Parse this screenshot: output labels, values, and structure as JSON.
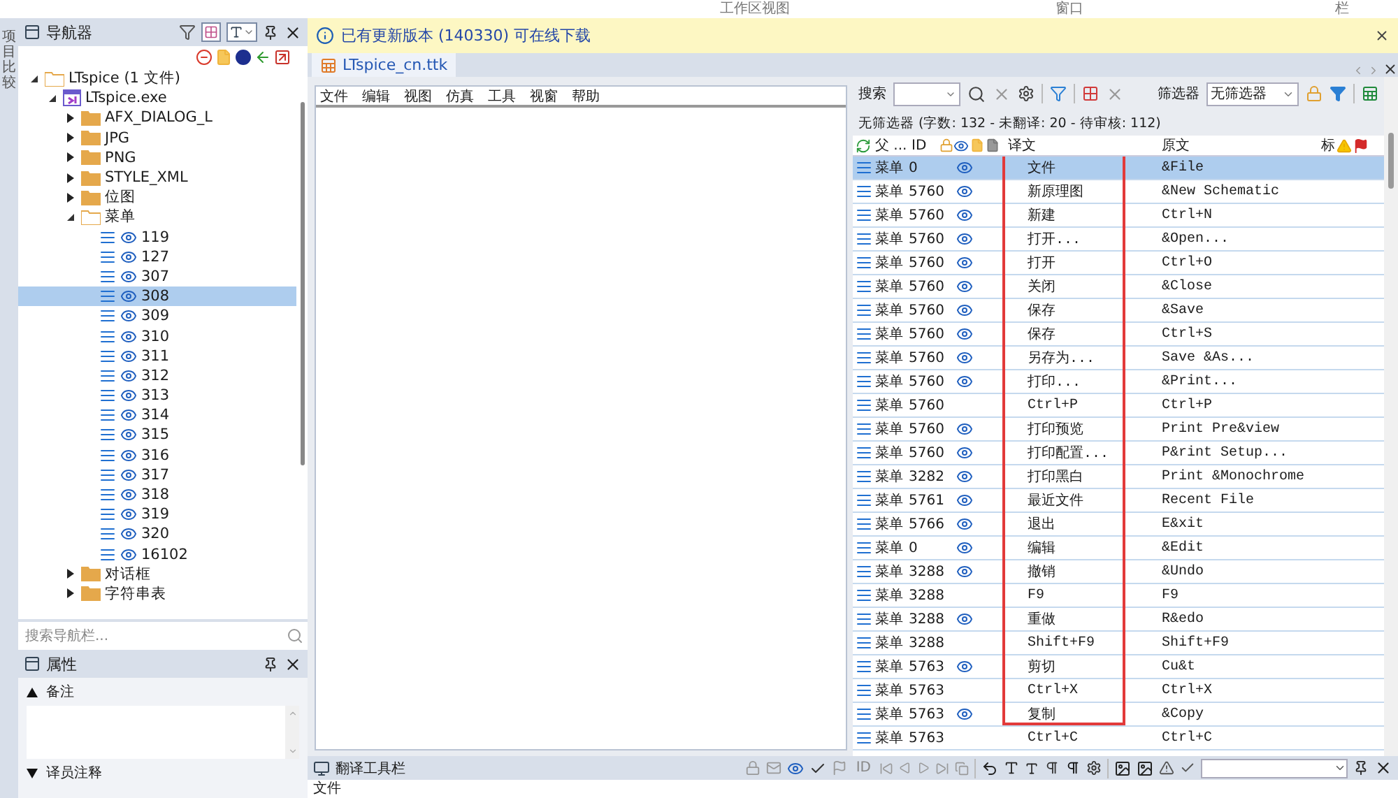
{
  "top_strip": [
    "工作区视图",
    "窗口",
    "栏"
  ],
  "side_tab": "项目比较",
  "navigator": {
    "title": "导航器",
    "tree": [
      {
        "label": "LTspice (1 文件)",
        "kind": "project",
        "expanded": true,
        "selected": false,
        "children": [
          {
            "label": "LTspice.exe",
            "kind": "file",
            "expanded": true,
            "selected": false,
            "children": [
              {
                "label": "AFX_DIALOG_L",
                "kind": "folder",
                "expanded": false,
                "selected": false
              },
              {
                "label": "JPG",
                "kind": "folder",
                "expanded": false,
                "selected": false
              },
              {
                "label": "PNG",
                "kind": "folder",
                "expanded": false,
                "selected": false
              },
              {
                "label": "STYLE_XML",
                "kind": "folder",
                "expanded": false,
                "selected": false
              },
              {
                "label": "位图",
                "kind": "folder",
                "expanded": false,
                "selected": false
              },
              {
                "label": "菜单",
                "kind": "folder",
                "expanded": true,
                "selected": false,
                "children": [
                  {
                    "label": "119",
                    "kind": "entry",
                    "selected": false
                  },
                  {
                    "label": "127",
                    "kind": "entry",
                    "selected": false
                  },
                  {
                    "label": "307",
                    "kind": "entry",
                    "selected": false
                  },
                  {
                    "label": "308",
                    "kind": "entry",
                    "selected": true
                  },
                  {
                    "label": "309",
                    "kind": "entry",
                    "selected": false
                  },
                  {
                    "label": "310",
                    "kind": "entry",
                    "selected": false
                  },
                  {
                    "label": "311",
                    "kind": "entry",
                    "selected": false
                  },
                  {
                    "label": "312",
                    "kind": "entry",
                    "selected": false
                  },
                  {
                    "label": "313",
                    "kind": "entry",
                    "selected": false
                  },
                  {
                    "label": "314",
                    "kind": "entry",
                    "selected": false
                  },
                  {
                    "label": "315",
                    "kind": "entry",
                    "selected": false
                  },
                  {
                    "label": "316",
                    "kind": "entry",
                    "selected": false
                  },
                  {
                    "label": "317",
                    "kind": "entry",
                    "selected": false
                  },
                  {
                    "label": "318",
                    "kind": "entry",
                    "selected": false
                  },
                  {
                    "label": "319",
                    "kind": "entry",
                    "selected": false
                  },
                  {
                    "label": "320",
                    "kind": "entry",
                    "selected": false
                  },
                  {
                    "label": "16102",
                    "kind": "entry",
                    "selected": false
                  }
                ]
              },
              {
                "label": "对话框",
                "kind": "folder",
                "expanded": false,
                "selected": false
              },
              {
                "label": "字符串表",
                "kind": "folder",
                "expanded": false,
                "selected": false
              }
            ]
          }
        ]
      }
    ],
    "search": {
      "placeholder": "搜索导航栏..."
    }
  },
  "properties": {
    "title": "属性",
    "sections": [
      {
        "label": "备注",
        "expanded": true
      },
      {
        "label": "译员注释",
        "expanded": false
      }
    ]
  },
  "info_bar": {
    "message": "已有更新版本 (140330) 可在线下载"
  },
  "document_tabs": [
    {
      "label": "LTspice_cn.ttk",
      "selected": true
    }
  ],
  "preview": {
    "menu": [
      "文件",
      "编辑",
      "视图",
      "仿真",
      "工具",
      "视窗",
      "帮助"
    ]
  },
  "grid": {
    "search_label": "搜索",
    "filter_label": "筛选器",
    "filter_value": "无筛选器",
    "summary": "无筛选器 (字数: 132 - 未翻译: 20 - 待审核: 112)",
    "columns": {
      "parent": "父 ...",
      "id": "ID",
      "translation": "译文",
      "source": "原文",
      "flag": "标"
    },
    "rows": [
      {
        "parent": "菜单",
        "id": "0",
        "visible": true,
        "translation": "文件",
        "source": "&File",
        "selected": true
      },
      {
        "parent": "菜单",
        "id": "5760",
        "visible": true,
        "translation": "新原理图",
        "source": "&New Schematic",
        "selected": false
      },
      {
        "parent": "菜单",
        "id": "5760",
        "visible": true,
        "translation": "新建",
        "source": "Ctrl+N",
        "selected": false
      },
      {
        "parent": "菜单",
        "id": "5760",
        "visible": true,
        "translation": "打开...",
        "source": "&Open...",
        "selected": false
      },
      {
        "parent": "菜单",
        "id": "5760",
        "visible": true,
        "translation": "打开",
        "source": "Ctrl+O",
        "selected": false
      },
      {
        "parent": "菜单",
        "id": "5760",
        "visible": true,
        "translation": "关闭",
        "source": "&Close",
        "selected": false
      },
      {
        "parent": "菜单",
        "id": "5760",
        "visible": true,
        "translation": "保存",
        "source": "&Save",
        "selected": false
      },
      {
        "parent": "菜单",
        "id": "5760",
        "visible": true,
        "translation": "保存",
        "source": "Ctrl+S",
        "selected": false
      },
      {
        "parent": "菜单",
        "id": "5760",
        "visible": true,
        "translation": "另存为...",
        "source": "Save &As...",
        "selected": false
      },
      {
        "parent": "菜单",
        "id": "5760",
        "visible": true,
        "translation": "打印...",
        "source": "&Print...",
        "selected": false
      },
      {
        "parent": "菜单",
        "id": "5760",
        "visible": false,
        "translation": "Ctrl+P",
        "source": "Ctrl+P",
        "selected": false
      },
      {
        "parent": "菜单",
        "id": "5760",
        "visible": true,
        "translation": "打印预览",
        "source": "Print Pre&view",
        "selected": false
      },
      {
        "parent": "菜单",
        "id": "5760",
        "visible": true,
        "translation": "打印配置...",
        "source": "P&rint Setup...",
        "selected": false
      },
      {
        "parent": "菜单",
        "id": "3282",
        "visible": true,
        "translation": "打印黑白",
        "source": "Print &Monochrome",
        "selected": false
      },
      {
        "parent": "菜单",
        "id": "5761",
        "visible": true,
        "translation": "最近文件",
        "source": "Recent File",
        "selected": false
      },
      {
        "parent": "菜单",
        "id": "5766",
        "visible": true,
        "translation": "退出",
        "source": "E&xit",
        "selected": false
      },
      {
        "parent": "菜单",
        "id": "0",
        "visible": true,
        "translation": "编辑",
        "source": "&Edit",
        "selected": false
      },
      {
        "parent": "菜单",
        "id": "3288",
        "visible": true,
        "translation": "撤销",
        "source": "&Undo",
        "selected": false
      },
      {
        "parent": "菜单",
        "id": "3288",
        "visible": false,
        "translation": "F9",
        "source": "F9",
        "selected": false
      },
      {
        "parent": "菜单",
        "id": "3288",
        "visible": true,
        "translation": "重做",
        "source": "R&edo",
        "selected": false
      },
      {
        "parent": "菜单",
        "id": "3288",
        "visible": false,
        "translation": "Shift+F9",
        "source": "Shift+F9",
        "selected": false
      },
      {
        "parent": "菜单",
        "id": "5763",
        "visible": true,
        "translation": "剪切",
        "source": "Cu&t",
        "selected": false
      },
      {
        "parent": "菜单",
        "id": "5763",
        "visible": false,
        "translation": "Ctrl+X",
        "source": "Ctrl+X",
        "selected": false
      },
      {
        "parent": "菜单",
        "id": "5763",
        "visible": true,
        "translation": "复制",
        "source": "&Copy",
        "selected": false
      },
      {
        "parent": "菜单",
        "id": "5763",
        "visible": false,
        "translation": "Ctrl+C",
        "source": "Ctrl+C",
        "selected": false
      }
    ]
  },
  "translation_toolbar": {
    "title": "翻译工具栏",
    "id_button": "ID"
  },
  "editor": {
    "text": "文件"
  }
}
